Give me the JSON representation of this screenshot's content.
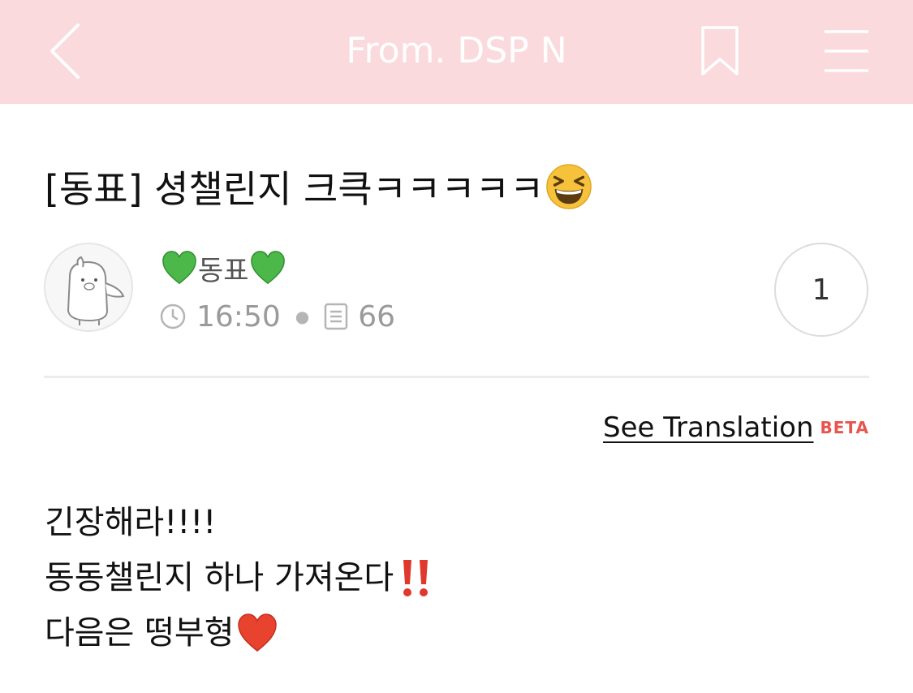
{
  "header": {
    "title": "From. DSP N",
    "background": "#fadadd",
    "back_icon": "chevron-left-icon",
    "bookmark_icon": "bookmark-icon",
    "menu_icon": "hamburger-menu-icon"
  },
  "post": {
    "title": "[동표] 셩챌린지 크큭ㅋㅋㅋㅋㅋ",
    "title_emoji": "grinning-squinting-face-emoji",
    "author": {
      "name": "동표",
      "decoration_emoji": "green-heart-emoji",
      "avatar": "penguin-avatar"
    },
    "time": "16:50",
    "views": "66",
    "comment_count": "1",
    "translate_label": "See Translation",
    "beta_label": "BETA",
    "beta_color": "#e8554e",
    "body_lines": [
      "긴장해라!!!!",
      "동동챌린지 하나 가져온다",
      "다음은 떵부형"
    ],
    "body_emojis": [
      "double-exclamation-emoji",
      "red-heart-emoji"
    ]
  }
}
